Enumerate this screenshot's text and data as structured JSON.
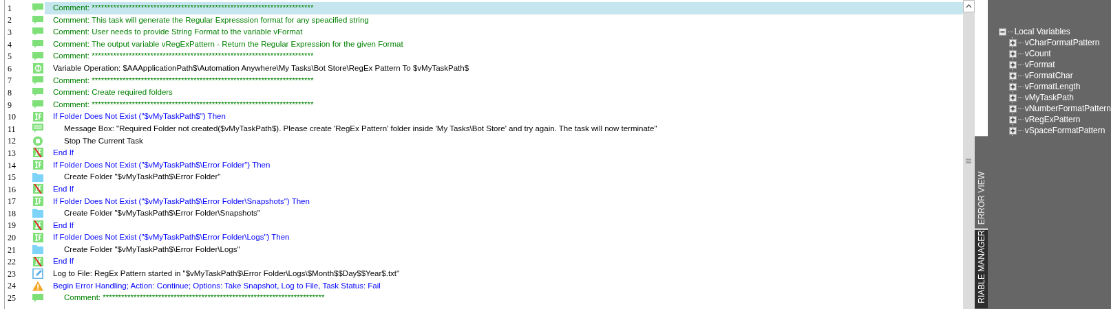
{
  "task_lines": [
    {
      "number": "1",
      "kind": "comment",
      "text": "Comment: ************************************************************************",
      "selected": true
    },
    {
      "number": "2",
      "kind": "comment",
      "text": "Comment: This task will generate the Regular Expresssion format for any speacified string",
      "selected": false
    },
    {
      "number": "3",
      "kind": "comment",
      "text": "Comment: User needs to provide String Format to the variable vFormat",
      "selected": false
    },
    {
      "number": "4",
      "kind": "comment",
      "text": "Comment: The output variable vRegExPattern - Return the Regular Expression for the given Format",
      "selected": false
    },
    {
      "number": "5",
      "kind": "comment",
      "text": "Comment: ************************************************************************",
      "selected": false
    },
    {
      "number": "6",
      "kind": "variable",
      "text": "Variable Operation: $AAApplicationPath$\\Automation Anywhere\\My Tasks\\Bot Store\\RegEx Pattern To $vMyTaskPath$",
      "selected": false
    },
    {
      "number": "7",
      "kind": "comment",
      "text": "Comment: ************************************************************************",
      "selected": false
    },
    {
      "number": "8",
      "kind": "comment",
      "text": "Comment: Create required folders",
      "selected": false
    },
    {
      "number": "9",
      "kind": "comment",
      "text": "Comment: ************************************************************************",
      "selected": false
    },
    {
      "number": "10",
      "kind": "if",
      "text": "If Folder Does Not Exist (\"$vMyTaskPath$\")  Then",
      "selected": false,
      "children": [
        {
          "number": "11",
          "kind": "message",
          "text": "Message Box: \"Required Folder not created($vMyTaskPath$). Please create 'RegEx Pattern' folder inside 'My Tasks\\Bot Store' and try again. The task will now terminate\"",
          "selected": false
        },
        {
          "number": "12",
          "kind": "stop",
          "text": "Stop The Current Task",
          "selected": false
        }
      ]
    },
    {
      "number": "13",
      "kind": "endif",
      "text": "End If",
      "selected": false
    },
    {
      "number": "14",
      "kind": "if",
      "text": "If Folder Does Not Exist (\"$vMyTaskPath$\\Error Folder\")  Then",
      "selected": false,
      "children": [
        {
          "number": "15",
          "kind": "folder",
          "text": "Create Folder \"$vMyTaskPath$\\Error Folder\"",
          "selected": false
        }
      ]
    },
    {
      "number": "16",
      "kind": "endif",
      "text": "End If",
      "selected": false
    },
    {
      "number": "17",
      "kind": "if",
      "text": "If Folder Does Not Exist (\"$vMyTaskPath$\\Error Folder\\Snapshots\")  Then",
      "selected": false,
      "children": [
        {
          "number": "18",
          "kind": "folder",
          "text": "Create Folder \"$vMyTaskPath$\\Error Folder\\Snapshots\"",
          "selected": false
        }
      ]
    },
    {
      "number": "19",
      "kind": "endif",
      "text": "End If",
      "selected": false
    },
    {
      "number": "20",
      "kind": "if",
      "text": "If Folder Does Not Exist (\"$vMyTaskPath$\\Error Folder\\Logs\")  Then",
      "selected": false,
      "children": [
        {
          "number": "21",
          "kind": "folder",
          "text": "Create Folder \"$vMyTaskPath$\\Error Folder\\Logs\"",
          "selected": false
        }
      ]
    },
    {
      "number": "22",
      "kind": "endif",
      "text": "End If",
      "selected": false
    },
    {
      "number": "23",
      "kind": "log",
      "text": "Log to File: RegEx Pattern started in \"$vMyTaskPath$\\Error Folder\\Logs\\$Month$$Day$$Year$.txt\"",
      "selected": false
    },
    {
      "number": "24",
      "kind": "error",
      "text": "Begin Error Handling; Action: Continue; Options: Take Snapshot, Log to File,  Task Status: Fail",
      "selected": false,
      "children": [
        {
          "number": "25",
          "kind": "comment",
          "text": "Comment: ************************************************************************",
          "selected": false
        }
      ]
    }
  ],
  "side_tabs": [
    {
      "label": "ERROR VIEW",
      "selected": false
    },
    {
      "label": "RIABLE MANAGER",
      "selected": true
    }
  ],
  "variables_tree": [
    {
      "label": "Local Variables",
      "expanded": true,
      "children": [
        {
          "label": "vCharFormatPattern",
          "expanded": false
        },
        {
          "label": "vCount",
          "expanded": false
        },
        {
          "label": "vFormat",
          "expanded": false
        },
        {
          "label": "vFormatChar",
          "expanded": false
        },
        {
          "label": "vFormatLength",
          "expanded": false
        },
        {
          "label": "vMyTaskPath",
          "expanded": false
        },
        {
          "label": "vNumberFormatPattern",
          "expanded": false
        },
        {
          "label": "vRegExPattern",
          "expanded": false
        },
        {
          "label": "vSpaceFormatPattern",
          "expanded": false
        }
      ]
    }
  ]
}
